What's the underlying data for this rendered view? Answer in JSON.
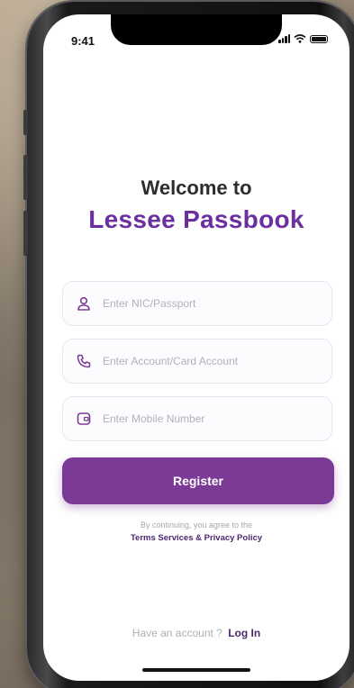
{
  "status_bar": {
    "time": "9:41"
  },
  "header": {
    "welcome": "Welcome to",
    "app_name": "Lessee Passbook"
  },
  "form": {
    "nic": {
      "placeholder": "Enter NIC/Passport",
      "value": "",
      "icon": "user-icon"
    },
    "account": {
      "placeholder": "Enter Account/Card Account",
      "value": "",
      "icon": "phone-icon"
    },
    "mobile": {
      "placeholder": "Enter Mobile Number",
      "value": "",
      "icon": "mobile-icon"
    },
    "register_label": "Register"
  },
  "consent": {
    "text": "By continuing, you agree to the",
    "policy_link": "Terms Services & Privacy Policy"
  },
  "footer": {
    "prompt": "Have an account ?",
    "login_label": "Log In"
  },
  "colors": {
    "brand": "#6b2fa0",
    "button": "#7b3a95",
    "link": "#4d2970"
  }
}
